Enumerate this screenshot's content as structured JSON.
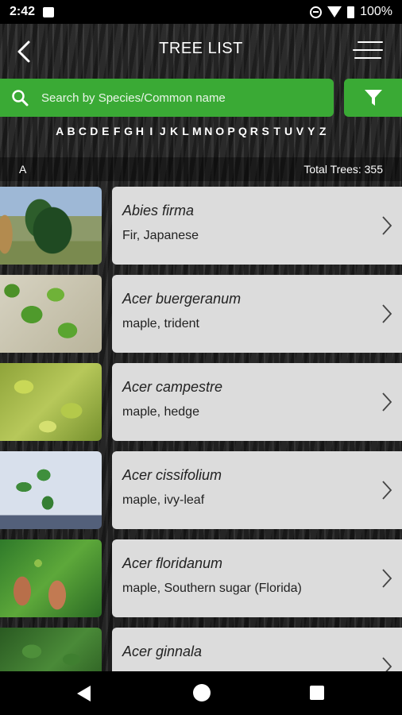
{
  "status": {
    "time": "2:42",
    "battery": "100%"
  },
  "header": {
    "title": "TREE LIST"
  },
  "search": {
    "placeholder": "Search by Species/Common name"
  },
  "alphabet": [
    "A",
    "B",
    "C",
    "D",
    "E",
    "F",
    "G",
    "H",
    "I",
    "J",
    "K",
    "L",
    "M",
    "N",
    "O",
    "P",
    "Q",
    "R",
    "S",
    "T",
    "U",
    "V",
    "Y",
    "Z"
  ],
  "section": {
    "letter": "A",
    "total": "Total Trees: 355"
  },
  "trees": [
    {
      "scientific": "Abies firma",
      "common": "Fir, Japanese"
    },
    {
      "scientific": "Acer buergeranum",
      "common": "maple, trident"
    },
    {
      "scientific": "Acer campestre",
      "common": "maple, hedge"
    },
    {
      "scientific": "Acer cissifolium",
      "common": "maple, ivy-leaf"
    },
    {
      "scientific": "Acer floridanum",
      "common": "maple, Southern sugar (Florida)"
    },
    {
      "scientific": "Acer ginnala",
      "common": ""
    }
  ],
  "colors": {
    "accent": "#3aaa35",
    "card": "#dcdcdc"
  }
}
